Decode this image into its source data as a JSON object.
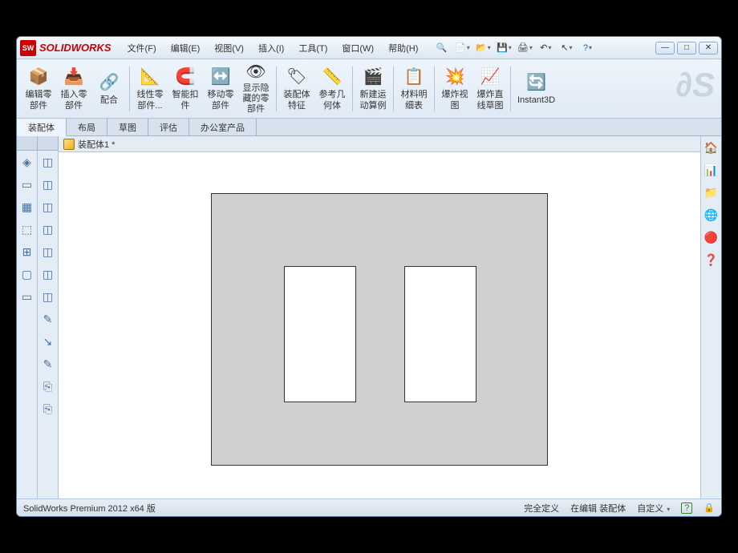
{
  "brand": "SOLIDWORKS",
  "menus": [
    "文件(F)",
    "编辑(E)",
    "视图(V)",
    "插入(I)",
    "工具(T)",
    "窗口(W)",
    "帮助(H)"
  ],
  "ribbon": [
    {
      "icon": "📦",
      "label": "编辑零\n部件"
    },
    {
      "icon": "📥",
      "label": "插入零\n部件"
    },
    {
      "icon": "🔗",
      "label": "配合"
    },
    {
      "icon": "📐",
      "label": "线性零\n部件..."
    },
    {
      "icon": "🧲",
      "label": "智能扣\n件"
    },
    {
      "icon": "↔️",
      "label": "移动零\n部件"
    },
    {
      "icon": "👁",
      "label": "显示隐\n藏的零\n部件"
    },
    {
      "icon": "🏷",
      "label": "装配体\n特征"
    },
    {
      "icon": "📏",
      "label": "参考几\n何体"
    },
    {
      "icon": "🎬",
      "label": "新建运\n动算例"
    },
    {
      "icon": "📋",
      "label": "材料明\n细表"
    },
    {
      "icon": "💥",
      "label": "爆炸视\n图"
    },
    {
      "icon": "📈",
      "label": "爆炸直\n线草图"
    },
    {
      "icon": "🔄",
      "label": "Instant3D"
    }
  ],
  "tabs": [
    "装配体",
    "布局",
    "草图",
    "评估",
    "办公室产品"
  ],
  "active_tab": 0,
  "doc_name": "装配体1 *",
  "status": {
    "left": "SolidWorks Premium 2012 x64 版",
    "r1": "完全定义",
    "r2": "在编辑 装配体",
    "r3": "自定义"
  },
  "left_icons_a": [
    "◈",
    "▭",
    "▦",
    "⬚",
    "⊞",
    "▢",
    "—",
    "▭"
  ],
  "left_icons_b": [
    "◫",
    "◫",
    "◫",
    "◫",
    "◫",
    "◫",
    "◫",
    "✎",
    "↘",
    "✎",
    "⎘",
    "⎘"
  ],
  "view_icons": [
    "🔍",
    "🔍",
    "✋",
    "🔄",
    "📦",
    "⬜",
    "📷",
    "🎨",
    "🔵",
    "⚙"
  ],
  "right_icons": [
    "🏠",
    "📊",
    "📁",
    "🌐",
    "🔴",
    "❓"
  ]
}
